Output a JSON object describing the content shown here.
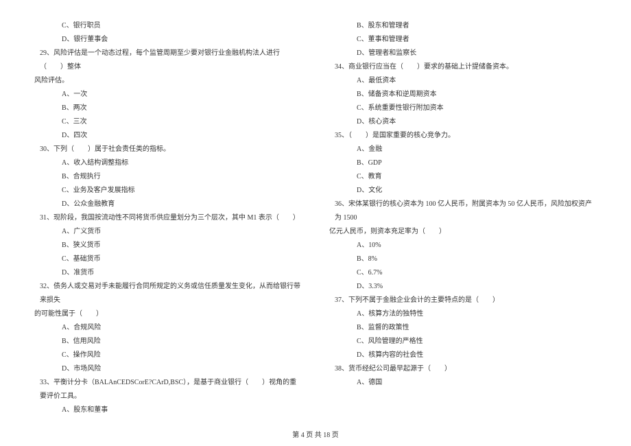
{
  "left_column": {
    "opt_28c": "C、银行职员",
    "opt_28d": "D、银行董事会",
    "q29": "29、风险评估是一个动态过程，每个监管周期至少要对银行业金融机构法人进行（　　）整体",
    "q29_cont": "风险评估。",
    "opt_29a": "A、一次",
    "opt_29b": "B、两次",
    "opt_29c": "C、三次",
    "opt_29d": "D、四次",
    "q30": "30、下列（　　）属于社会责任类的指标。",
    "opt_30a": "A、收入结构调整指标",
    "opt_30b": "B、合规执行",
    "opt_30c": "C、业务及客户发展指标",
    "opt_30d": "D、公众金融教育",
    "q31": "31、现阶段，我国按流动性不同将货币供应量划分为三个层次，其中 M1 表示（　　）",
    "opt_31a": "A、广义货币",
    "opt_31b": "B、狭义货币",
    "opt_31c": "C、基础货币",
    "opt_31d": "D、准货币",
    "q32": "32、债务人或交易对手未能履行合同所规定的义务或信任质量发生变化，从而给银行带来损失",
    "q32_cont": "的可能性属于（　　）",
    "opt_32a": "A、合规风险",
    "opt_32b": "B、信用风险",
    "opt_32c": "C、操作风险",
    "opt_32d": "D、市场风险",
    "q33": "33、平衡计分卡（BALAnCEDSCorE?CArD,BSC），是基于商业银行（　　）视角的重要评价工具。",
    "opt_33a": "A、股东和董事"
  },
  "right_column": {
    "opt_33b": "B、股东和管理者",
    "opt_33c": "C、董事和管理者",
    "opt_33d": "D、管理者和监察长",
    "q34": "34、商业银行应当在（　　）要求的基础上计提储备资本。",
    "opt_34a": "A、最低资本",
    "opt_34b": "B、储备资本和逆周期资本",
    "opt_34c": "C、系统重要性银行附加资本",
    "opt_34d": "D、核心资本",
    "q35": "35、（　　）是国家重要的核心竞争力。",
    "opt_35a": "A、金融",
    "opt_35b": "B、GDP",
    "opt_35c": "C、教育",
    "opt_35d": "D、文化",
    "q36": "36、宋体某银行的核心资本为 100 亿人民币，附属资本为 50 亿人民币，风险加权资产为 1500",
    "q36_cont": "亿元人民币，则资本充足率为（　　）",
    "opt_36a": "A、10%",
    "opt_36b": "B、8%",
    "opt_36c": "C、6.7%",
    "opt_36d": "D、3.3%",
    "q37": "37、下列不属于金融企业会计的主要特点的是（　　）",
    "opt_37a": "A、核算方法的独特性",
    "opt_37b": "B、监督的政策性",
    "opt_37c": "C、风险管理的严格性",
    "opt_37d": "D、核算内容的社会性",
    "q38": "38、货币经纪公司最早起源于（　　）",
    "opt_38a": "A、德国"
  },
  "footer": "第 4 页 共 18 页"
}
